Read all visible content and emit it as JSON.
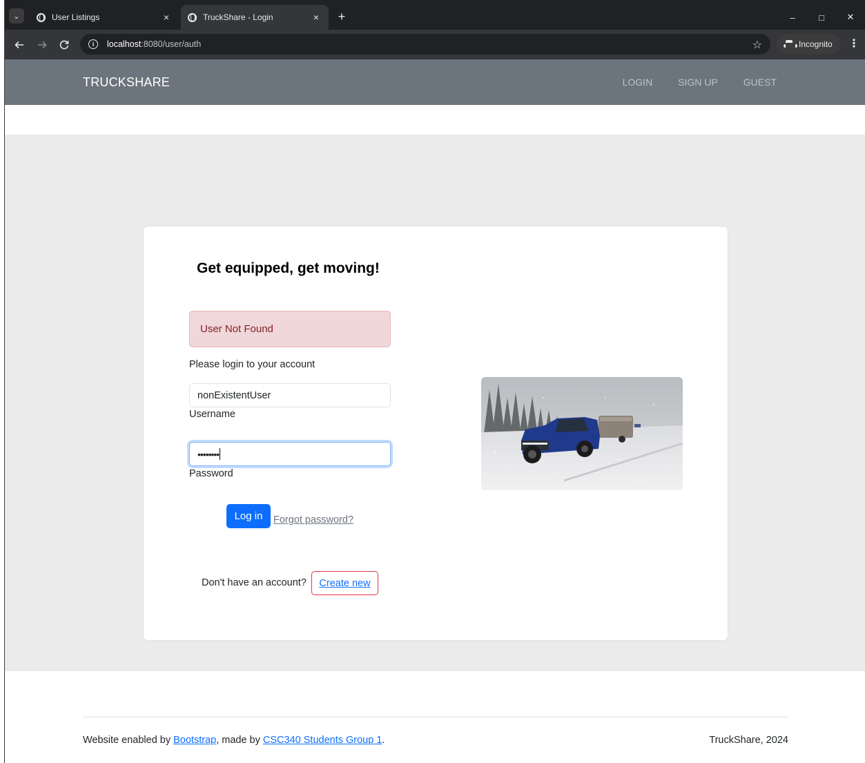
{
  "browser": {
    "tabs": [
      {
        "title": "User Listings",
        "close": "×"
      },
      {
        "title": "TruckShare - Login",
        "close": "×"
      }
    ],
    "new_tab": "+",
    "window_controls": {
      "minimize": "–",
      "maximize": "□",
      "close": "✕"
    },
    "url_host": "localhost",
    "url_rest": ":8080/user/auth",
    "incognito_label": "Incognito",
    "icons": {
      "back": "arrow-left-icon",
      "forward": "arrow-right-icon",
      "reload": "reload-icon",
      "info": "info-icon",
      "bookmark": "star-icon",
      "menu": "kebab-menu-icon"
    }
  },
  "navbar": {
    "brand": "TRUCKSHARE",
    "links": [
      "LOGIN",
      "SIGN UP",
      "GUEST"
    ],
    "background": "#6c757d"
  },
  "login": {
    "heading": "Get equipped, get moving!",
    "alert": "User Not Found",
    "prompt": "Please login to your account",
    "username_value": "nonExistentUser",
    "username_label": "Username",
    "password_dots": "••••••••",
    "password_label": "Password",
    "login_button": "Log in",
    "forgot_link": "Forgot password?",
    "signup_prompt": "Don't have an account?",
    "create_button": "Create new"
  },
  "footer": {
    "prefix": "Website enabled by ",
    "bootstrap_link": "Bootstrap",
    "middle": ", made by ",
    "group_link": "CSC340 Students Group 1",
    "suffix": ".",
    "right": "TruckShare, 2024"
  },
  "colors": {
    "primary": "#0d6efd",
    "danger": "#dc3545",
    "alert_bg": "#f0d7d9",
    "alert_text": "#842029",
    "page_bg": "#ebebeb"
  }
}
